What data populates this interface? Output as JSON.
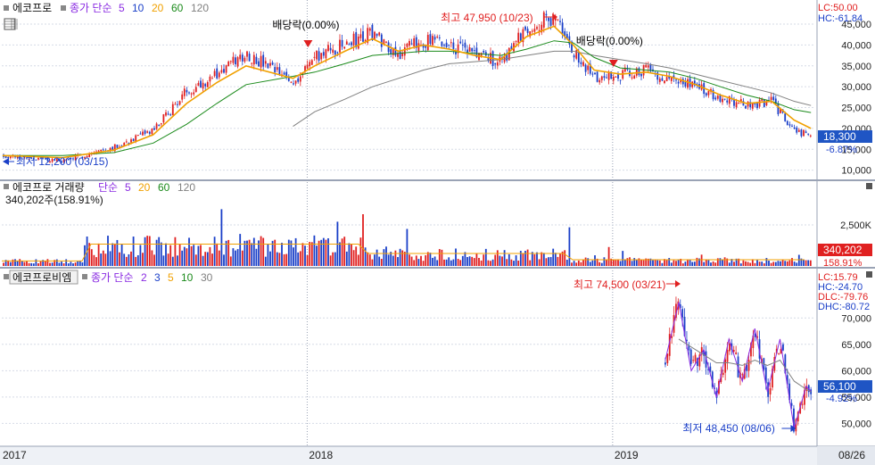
{
  "colors": {
    "up": "#e02020",
    "down": "#1a3fc8",
    "ma5": "#8a2be2",
    "ma10": "#1a3fc8",
    "ma20": "#f0a000",
    "ma60": "#1a8a1a",
    "ma120": "#808080",
    "ma30": "#808080",
    "grid": "#d6dbe6",
    "priceBox": "#1f55c4",
    "volBox": "#e02020",
    "axisText": "#222"
  },
  "header": {
    "top": {
      "name": "에코프로",
      "label": "종가 단순",
      "ma": [
        "5",
        "10",
        "20",
        "60",
        "120"
      ]
    },
    "vol": {
      "name": "에코프로 거래량",
      "label": "단순",
      "ma": [
        "5",
        "20",
        "60",
        "120"
      ],
      "last": "340,202주(158.91%)"
    },
    "bottom": {
      "name": "에코프로비엠",
      "label": "종가 단순",
      "ma": [
        "2",
        "3",
        "5",
        "10",
        "30"
      ]
    }
  },
  "icons": [
    "grid-icon",
    "close-icon",
    "square-icon"
  ],
  "x_axis": {
    "labels": [
      "2017",
      "2018",
      "2019",
      "08/26"
    ]
  },
  "chart_data": [
    {
      "type": "line",
      "title": "에코프로 종가 단순 5 10 20 60 120",
      "y_ticks": [
        "45,000",
        "40,000",
        "35,000",
        "30,000",
        "25,000",
        "20,000",
        "15,000",
        "10,000"
      ],
      "y_tick_values": [
        45000,
        40000,
        35000,
        30000,
        25000,
        20000,
        15000,
        10000
      ],
      "ylim": [
        8000,
        49500
      ],
      "x_dates": [
        "2017-01-02",
        "2017-03-15",
        "2017-05-15",
        "2017-07-01",
        "2017-08-10",
        "2017-09-15",
        "2017-10-20",
        "2017-12-15",
        "2018-01-10",
        "2018-02-15",
        "2018-03-20",
        "2018-04-20",
        "2018-05-20",
        "2018-06-20",
        "2018-07-20",
        "2018-08-20",
        "2018-09-20",
        "2018-10-23",
        "2018-11-15",
        "2018-12-10",
        "2019-01-10",
        "2019-02-10",
        "2019-03-10",
        "2019-04-10",
        "2019-05-10",
        "2019-06-10",
        "2019-07-10",
        "2019-08-06",
        "2019-08-26"
      ],
      "series": [
        {
          "name": "종가",
          "values": [
            13500,
            12200,
            15500,
            19500,
            29000,
            33000,
            38000,
            31000,
            37000,
            40000,
            43000,
            38000,
            41000,
            40000,
            38000,
            36000,
            44000,
            47000,
            38000,
            32000,
            33000,
            34000,
            32000,
            30000,
            27500,
            25500,
            26500,
            19500,
            18300
          ]
        },
        {
          "name": "20",
          "values": [
            13500,
            13000,
            14800,
            18500,
            26000,
            31000,
            35000,
            32000,
            35000,
            38500,
            41500,
            38500,
            40000,
            39000,
            37500,
            36500,
            42000,
            44500,
            40000,
            34000,
            33000,
            33500,
            32500,
            30500,
            28000,
            26000,
            26500,
            22000,
            20000
          ]
        },
        {
          "name": "60",
          "values": [
            13500,
            13500,
            14200,
            16500,
            21000,
            26000,
            30500,
            32500,
            33500,
            35500,
            37500,
            38000,
            38500,
            38500,
            38000,
            37500,
            39000,
            41000,
            40500,
            37000,
            34500,
            34000,
            33500,
            32000,
            30000,
            28000,
            26500,
            24500,
            23800
          ]
        },
        {
          "name": "120",
          "values": [
            null,
            null,
            null,
            null,
            null,
            null,
            null,
            20500,
            24000,
            27000,
            30000,
            32000,
            34000,
            35500,
            36000,
            36500,
            37500,
            38500,
            38500,
            37500,
            36500,
            35500,
            34500,
            33000,
            31500,
            30000,
            28500,
            26500,
            25500
          ]
        }
      ],
      "annotations": [
        {
          "text": "배당락(0.00%)",
          "date": "2018-01-02"
        },
        {
          "text": "최고 47,950 (10/23)",
          "date": "2018-10-23",
          "value": 47950
        },
        {
          "text": "배당락(0.00%)",
          "date": "2019-01-02"
        },
        {
          "text": "최저 12,200 (03/15)",
          "date": "2017-03-15",
          "value": 12200
        }
      ],
      "right_labels": {
        "lc": "LC:50.00",
        "hc": "HC:-61.84",
        "last_price": "18,300",
        "change": "-6.87%"
      }
    },
    {
      "type": "bar",
      "title": "에코프로 거래량 단순 5 20 60 120",
      "y_ticks": [
        "2,500K"
      ],
      "y_tick_values": [
        2500
      ],
      "last_value": "340,202",
      "last_change": "158.91%"
    },
    {
      "type": "line",
      "title": "에코프로비엠 종가 단순 2 3 5 10 30",
      "y_ticks": [
        "70,000",
        "65,000",
        "60,000",
        "55,000",
        "50,000"
      ],
      "y_tick_values": [
        70000,
        65000,
        60000,
        55000,
        50000
      ],
      "ylim": [
        46000,
        77500
      ],
      "x_dates": [
        "2019-03-05",
        "2019-03-21",
        "2019-04-05",
        "2019-04-20",
        "2019-05-05",
        "2019-05-20",
        "2019-06-05",
        "2019-06-20",
        "2019-07-05",
        "2019-07-20",
        "2019-08-06",
        "2019-08-20",
        "2019-08-26"
      ],
      "series": [
        {
          "name": "종가",
          "values": [
            62000,
            73000,
            60000,
            64000,
            55000,
            66000,
            58000,
            68000,
            56000,
            66000,
            49000,
            57000,
            56100
          ]
        },
        {
          "name": "30",
          "values": [
            null,
            66000,
            64500,
            63000,
            61500,
            61500,
            61000,
            62000,
            61000,
            62000,
            58000,
            56500,
            56000
          ]
        }
      ],
      "annotations": [
        {
          "text": "최고 74,500 (03/21)",
          "date": "2019-03-21",
          "value": 74500
        },
        {
          "text": "최저 48,450 (08/06)",
          "date": "2019-08-06",
          "value": 48450
        }
      ],
      "right_labels": {
        "lc": "LC:15.79",
        "hc": "HC:-24.70",
        "dlc": "DLC:-79.76",
        "dhc": "DHC:-80.72",
        "last_price": "56,100",
        "change": "-4.92%"
      }
    }
  ]
}
